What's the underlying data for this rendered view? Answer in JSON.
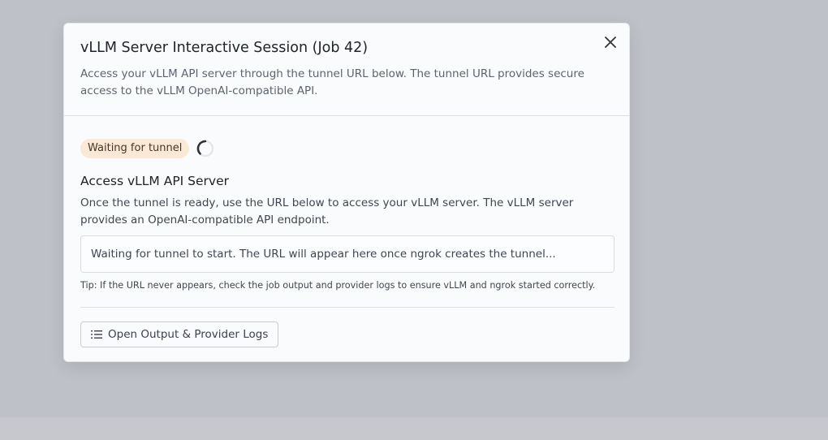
{
  "modal": {
    "title": "vLLM Server Interactive Session (Job 42)",
    "description": "Access your vLLM API server through the tunnel URL below. The tunnel URL provides secure access to the vLLM OpenAI-compatible API.",
    "close_icon": "close-icon"
  },
  "status": {
    "badge_label": "Waiting for tunnel",
    "badge_color": "#fbe9d8",
    "spinner_icon": "loading-spinner-icon"
  },
  "access": {
    "title": "Access vLLM API Server",
    "description": "Once the tunnel is ready, use the URL below to access your vLLM server. The vLLM server provides an OpenAI-compatible API endpoint.",
    "url_placeholder": "Waiting for tunnel to start. The URL will appear here once ngrok creates the tunnel...",
    "tip": "Tip: If the URL never appears, check the job output and provider logs to ensure vLLM and ngrok started correctly."
  },
  "actions": {
    "logs_button_label": "Open Output & Provider Logs",
    "logs_button_icon": "list-icon"
  }
}
